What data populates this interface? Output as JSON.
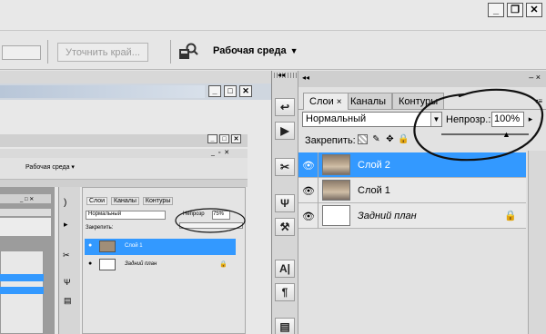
{
  "options_bar": {
    "refine_edge_label": "Уточнить край...",
    "workspace_label": "Рабочая среда"
  },
  "inner_mini": {
    "workspace_label": "Рабочая среда",
    "tabs": [
      "Слои",
      "Каналы",
      "Контуры"
    ],
    "blend": "Нормальный",
    "opacity_label": "Непрозр",
    "opacity": "75%",
    "lock_label": "Закрепить:",
    "layers": [
      "Слой 1",
      "Задний план"
    ]
  },
  "panel": {
    "tabs": [
      {
        "label": "Слои",
        "close": "×"
      },
      {
        "label": "Каналы"
      },
      {
        "label": "Контуры"
      }
    ],
    "blend_mode": "Нормальный",
    "opacity_label": "Непрозр.:",
    "opacity_value": "100%",
    "opacity_fraction": 1.0,
    "lock_label": "Закрепить:",
    "layers": [
      {
        "name": "Слой 2",
        "selected": true,
        "visible": true,
        "thumb": "photo",
        "italic": false
      },
      {
        "name": "Слой 1",
        "selected": false,
        "visible": true,
        "thumb": "photo",
        "italic": false
      },
      {
        "name": "Задний план",
        "selected": false,
        "visible": true,
        "thumb": "white",
        "italic": true,
        "locked": true
      }
    ]
  },
  "colors": {
    "selection": "#3399ff",
    "ink_annotation": "#111111"
  }
}
